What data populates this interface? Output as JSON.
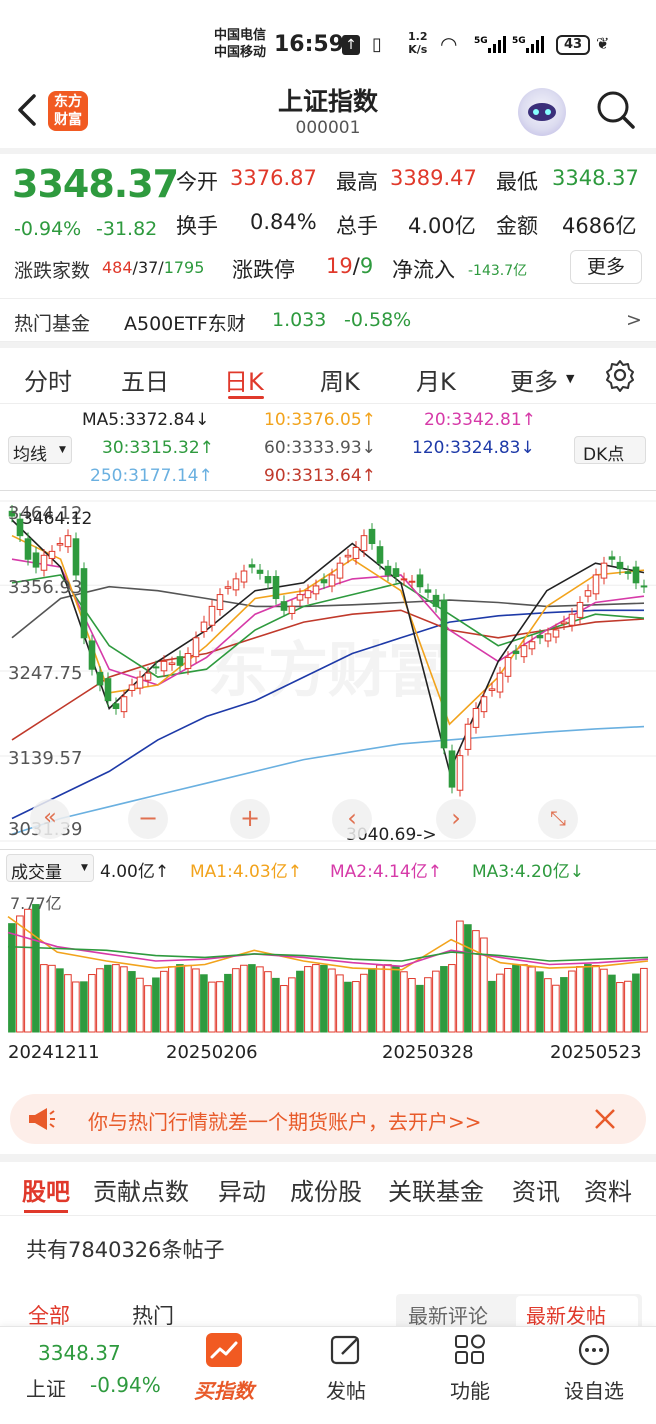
{
  "status": {
    "carrier1": "中国电信",
    "carrier2": "中国移动",
    "time": "16:59",
    "speed_num": "1.2",
    "speed_unit": "K/s",
    "battery": "43"
  },
  "header": {
    "title": "上证指数",
    "code": "000001",
    "logo_line1": "东方",
    "logo_line2": "财富"
  },
  "quote": {
    "price": "3348.37",
    "change_pct": "-0.94%",
    "change": "-31.82",
    "open_label": "今开",
    "open": "3376.87",
    "high_label": "最高",
    "high": "3389.47",
    "low_label": "最低",
    "low": "3348.37",
    "turnover_label": "换手",
    "turnover": "0.84%",
    "volume_label": "总手",
    "volume": "4.00亿",
    "amount_label": "金额",
    "amount": "4686亿",
    "breadth_label": "涨跌家数",
    "breadth_up": "484",
    "breadth_flat": "/37/",
    "breadth_down": "1795",
    "limit_label": "涨跌停",
    "limit_up": "19",
    "limit_sep": "/",
    "limit_down": "9",
    "netflow_label": "净流入",
    "netflow": "-143.7亿",
    "more": "更多"
  },
  "fund": {
    "label": "热门基金",
    "name": "A500ETF东财",
    "price": "1.033",
    "change": "-0.58%",
    "arrow": ">"
  },
  "tabs": [
    "分时",
    "五日",
    "日K",
    "周K",
    "月K",
    "更多"
  ],
  "ma": {
    "selector": "均线",
    "dk": "DK点",
    "ma5": "MA5:3372.84↓",
    "ma10": "10:3376.05↑",
    "ma20": "20:3342.81↑",
    "ma30": "30:3315.32↑",
    "ma60": "60:3333.93↓",
    "ma120": "120:3324.83↓",
    "ma250": "250:3177.14↑",
    "ma90": "90:3313.64↑",
    "colors": {
      "ma5": "#222222",
      "ma10": "#f2a31c",
      "ma20": "#d63aa8",
      "ma30": "#2e9a3e",
      "ma60": "#555555",
      "ma120": "#1e3aa8",
      "ma250": "#6ab0e0",
      "ma90": "#c0392b"
    }
  },
  "kline": {
    "y_labels": [
      "3464.12",
      "3356.93",
      "3247.75",
      "3139.57",
      "3031.39"
    ],
    "high_mark": "3464.12",
    "low_mark": "3040.69->",
    "watermark": "东方财富",
    "controls": [
      "«",
      "−",
      "+",
      "‹",
      "›",
      "⤡"
    ]
  },
  "volume": {
    "selector": "成交量",
    "value": "4.00亿↑",
    "ma1": "MA1:4.03亿↑",
    "ma2": "MA2:4.14亿↑",
    "ma3": "MA3:4.20亿↓",
    "y_top": "7.77亿",
    "dates": [
      "20241211",
      "20250206",
      "20250328",
      "20250523"
    ]
  },
  "ad": {
    "text": "你与热门行情就差一个期货账户，去开户>>"
  },
  "bottom_tabs": [
    "股吧",
    "贡献点数",
    "异动",
    "成份股",
    "关联基金",
    "资讯",
    "资料"
  ],
  "posts": {
    "count": "共有7840326条帖子",
    "sub_tabs": [
      "全部",
      "热门"
    ],
    "sort": [
      "最新评论",
      "最新发帖"
    ]
  },
  "nav": {
    "price": "3348.37",
    "name": "上证",
    "change": "-0.94%",
    "items": [
      "买指数",
      "发帖",
      "功能",
      "设自选"
    ]
  },
  "chart_data": {
    "type": "candlestick",
    "ylim": [
      3031.39,
      3464.12
    ],
    "note": "Daily K-line of 上证指数 from 20241211 to 20250523",
    "x": [
      "20241211",
      "20250206",
      "20250328",
      "20250523"
    ],
    "y_ticks": [
      3464.12,
      3356.93,
      3247.75,
      3139.57,
      3031.39
    ],
    "high": 3464.12,
    "low": 3040.69,
    "series": [
      {
        "name": "MA5",
        "last": 3372.84
      },
      {
        "name": "10",
        "last": 3376.05
      },
      {
        "name": "20",
        "last": 3342.81
      },
      {
        "name": "30",
        "last": 3315.32
      },
      {
        "name": "60",
        "last": 3333.93
      },
      {
        "name": "120",
        "last": 3324.83
      },
      {
        "name": "250",
        "last": 3177.14
      },
      {
        "name": "90",
        "last": 3313.64
      }
    ]
  }
}
